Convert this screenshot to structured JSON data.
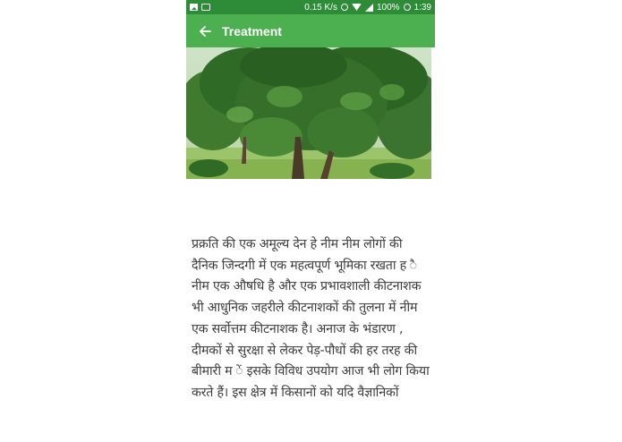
{
  "status_bar": {
    "network_speed": "0.15 K/s",
    "battery": "100%",
    "time": "1:39",
    "icons": [
      "image-icon",
      "robot-icon",
      "clock-icon",
      "wifi-icon",
      "signal-icon",
      "battery-icon"
    ]
  },
  "app_bar": {
    "title": "Treatment",
    "back_icon": "arrow-left-icon"
  },
  "hero": {
    "subject": "neem tree photo"
  },
  "article": {
    "text": "प्रक्रति की एक अमूल्य देन हे नीम नीम लोगों की दैनिक जिन्दगी में एक महत्वपूर्ण भूमिका रखता ह ै नीम एक औषधि है और एक प्रभावशाली कीटनाशक भी आधुनिक जहरीले कीटनाशकों की तुलना में नीम एक सर्वोत्तम कीटनाशक है। अनाज के भंडारण , दीमकों से सुरक्षा से लेकर पेड़-पौधों की हर तरह की बीमारी म ें इसके विविध उपयोग आज भी लोग किया करते हैं। इस क्षेत्र में किसानों को यदि वैज्ञानिकों"
  },
  "colors": {
    "status_bar": "#2e8b37",
    "app_bar": "#4caf50",
    "text": "#3c3c3c"
  }
}
